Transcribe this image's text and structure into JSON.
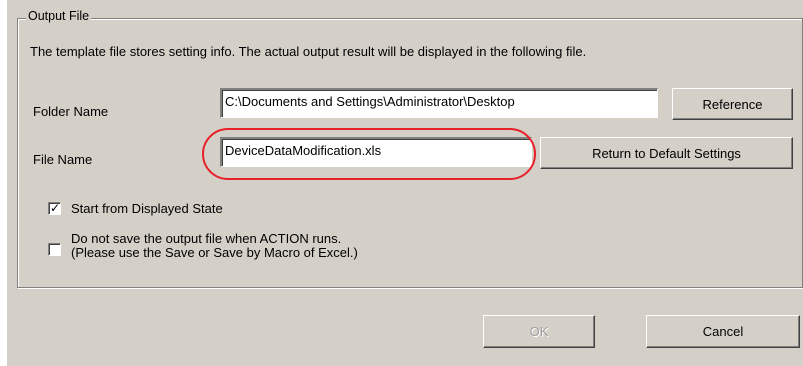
{
  "group": {
    "title": "Output File",
    "description": "The template file stores setting info. The actual output result will be displayed in the following file."
  },
  "folder": {
    "label": "Folder Name",
    "value": "C:\\Documents and Settings\\Administrator\\Desktop",
    "button_label": "Reference"
  },
  "file": {
    "label": "File Name",
    "value": "DeviceDataModification.xls",
    "button_label": "Return to Default Settings"
  },
  "options": {
    "start_from_displayed_state": {
      "label": "Start from Displayed State",
      "checked": true
    },
    "do_not_save": {
      "label_line1": "Do not save the output file when ACTION runs.",
      "label_line2": "(Please use the Save or Save by Macro of Excel.)",
      "checked": false
    }
  },
  "footer": {
    "ok_label": "OK",
    "ok_enabled": false,
    "cancel_label": "Cancel"
  },
  "colors": {
    "dialog_bg": "#d4d0c8",
    "highlight": "#e8202a"
  }
}
